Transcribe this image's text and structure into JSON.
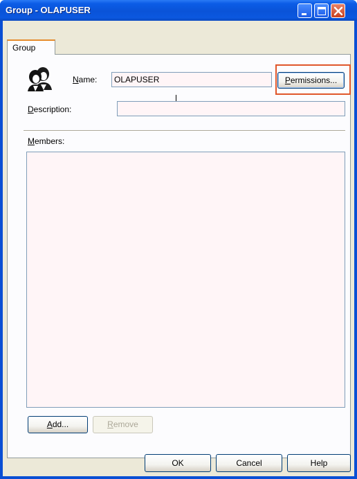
{
  "window": {
    "title": "Group - OLAPUSER"
  },
  "titlebar_buttons": {
    "minimize_icon": "minimize-icon",
    "maximize_icon": "maximize-icon",
    "close_icon": "close-icon"
  },
  "tabs": [
    {
      "label": "Group",
      "selected": true
    }
  ],
  "form": {
    "name": {
      "label_accel": "N",
      "label_rest": "ame:",
      "value": "OLAPUSER"
    },
    "permissions_button": {
      "accel": "P",
      "rest": "ermissions..."
    },
    "description": {
      "label_accel": "D",
      "label_rest": "escription:",
      "value": ""
    },
    "members": {
      "label_accel": "M",
      "label_rest": "embers:",
      "items": []
    }
  },
  "list_buttons": {
    "add": {
      "accel": "A",
      "rest": "dd...",
      "enabled": true
    },
    "remove": {
      "accel": "R",
      "rest": "emove",
      "enabled": false
    }
  },
  "dialog_buttons": {
    "ok": "OK",
    "cancel": "Cancel",
    "help": "Help"
  },
  "colors": {
    "titlebar": "#0a53d8",
    "highlight": "#e0562a",
    "field_background": "#fff5f7"
  },
  "icons": {
    "group": "group-users-icon"
  }
}
